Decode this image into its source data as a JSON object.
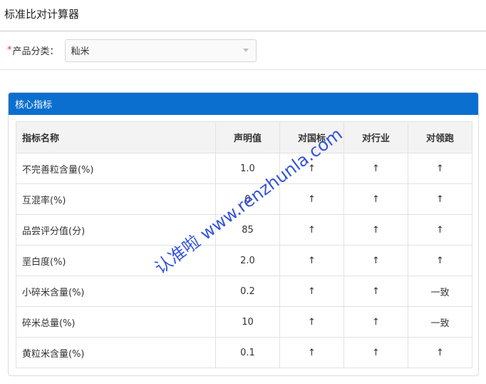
{
  "header": {
    "title": "标准比对计算器"
  },
  "filter": {
    "required_mark": "*",
    "label": "产品分类：",
    "selected": "籼米"
  },
  "panel": {
    "title": "核心指标"
  },
  "table": {
    "columns": [
      "指标名称",
      "声明值",
      "对国标",
      "对行业",
      "对领跑"
    ],
    "rows": [
      {
        "name": "不完善粒含量(%)",
        "value": "1.0",
        "national": "↑",
        "industry": "↑",
        "leader": "↑"
      },
      {
        "name": "互混率(%)",
        "value": "0",
        "national": "↑",
        "industry": "↑",
        "leader": "↑"
      },
      {
        "name": "品尝评分值(分)",
        "value": "85",
        "national": "↑",
        "industry": "↑",
        "leader": "↑"
      },
      {
        "name": "垩白度(%)",
        "value": "2.0",
        "national": "↑",
        "industry": "↑",
        "leader": "↑"
      },
      {
        "name": "小碎米含量(%)",
        "value": "0.2",
        "national": "↑",
        "industry": "↑",
        "leader": "一致"
      },
      {
        "name": "碎米总量(%)",
        "value": "10",
        "national": "↑",
        "industry": "↑",
        "leader": "一致"
      },
      {
        "name": "黄粒米含量(%)",
        "value": "0.1",
        "national": "↑",
        "industry": "↑",
        "leader": "↑"
      }
    ]
  },
  "watermark": {
    "text": "认准啦 www.renzhunla.com"
  },
  "colors": {
    "accent": "#0b6fcf",
    "arrow": "#22b14c",
    "required": "#e33333"
  }
}
